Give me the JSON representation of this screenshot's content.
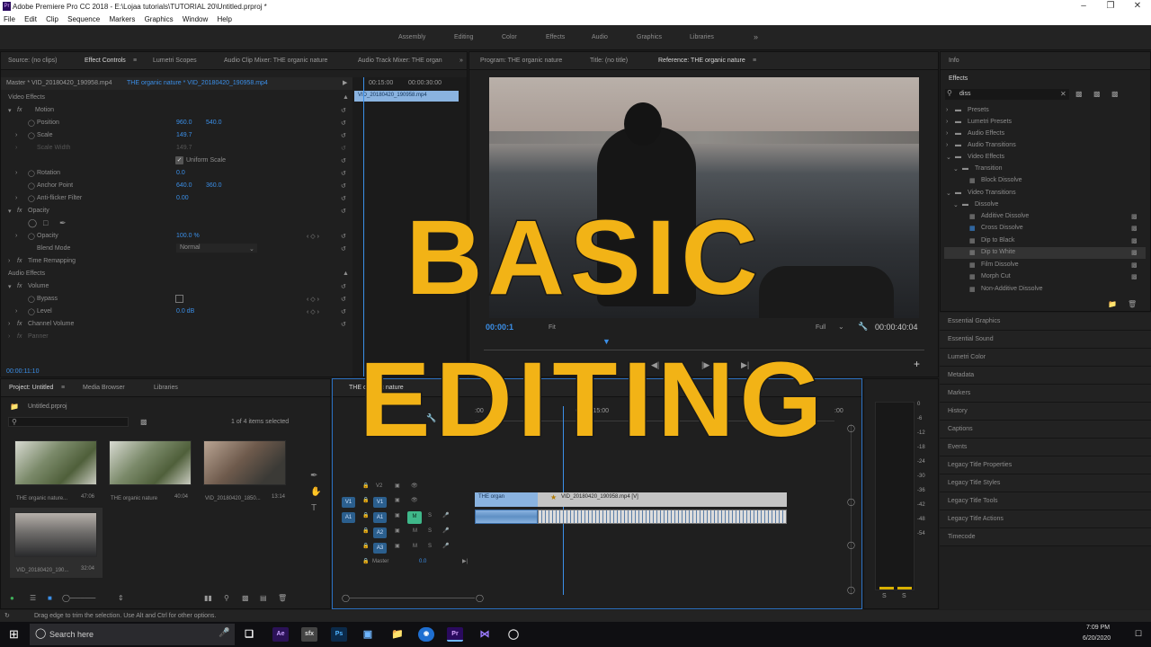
{
  "window": {
    "title": "Adobe Premiere Pro CC 2018 - E:\\Lojaa tutorials\\TUTORIAL 20\\Untitled.prproj *",
    "logo": "Pr"
  },
  "menu": [
    "File",
    "Edit",
    "Clip",
    "Sequence",
    "Markers",
    "Graphics",
    "Window",
    "Help"
  ],
  "workspaces": [
    "Assembly",
    "Editing",
    "Color",
    "Effects",
    "Audio",
    "Graphics",
    "Libraries"
  ],
  "source_tabs": [
    "Source: (no clips)",
    "Effect Controls",
    "Lumetri Scopes",
    "Audio Clip Mixer: THE organic nature",
    "Audio Track Mixer: THE organ"
  ],
  "effect_controls": {
    "master": "Master * VID_20180420_190958.mp4",
    "clip": "THE organic nature * VID_20180420_190958.mp4",
    "video_effects": "Video Effects",
    "motion": "Motion",
    "position_label": "Position",
    "position_x": "960.0",
    "position_y": "540.0",
    "scale_label": "Scale",
    "scale_value": "149.7",
    "scale_width_label": "Scale Width",
    "scale_width_value": "149.7",
    "uniform_scale": "Uniform Scale",
    "rotation_label": "Rotation",
    "rotation_value": "0.0",
    "anchor_label": "Anchor Point",
    "anchor_x": "640.0",
    "anchor_y": "360.0",
    "flicker_label": "Anti-flicker Filter",
    "flicker_value": "0.00",
    "opacity": "Opacity",
    "opacity_label": "Opacity",
    "opacity_value": "100.0 %",
    "blend_label": "Blend Mode",
    "blend_value": "Normal",
    "time_remap": "Time Remapping",
    "audio_effects": "Audio Effects",
    "volume": "Volume",
    "bypass_label": "Bypass",
    "level_label": "Level",
    "level_value": "0.0 dB",
    "channel_volume": "Channel Volume",
    "panner": "Panner",
    "mini_time1": "00:15:00",
    "mini_time2": "00:00:30:00",
    "mini_clip": "VID_20180420_190958.mp4",
    "timecode": "00:00:11:10"
  },
  "program_tabs": [
    "Program: THE organic nature",
    "Title: (no title)",
    "Reference: THE organic nature"
  ],
  "program": {
    "time_left": "00:00:1",
    "fit": "Fit",
    "full": "Full",
    "time_right": "00:00:40:04"
  },
  "project": {
    "tabs": [
      "Project: Untitled",
      "Media Browser",
      "Libraries"
    ],
    "file": "Untitled.prproj",
    "count": "1 of 4 items selected",
    "items": [
      {
        "name": "THE organic nature...",
        "duration": "47:06"
      },
      {
        "name": "THE organic nature",
        "duration": "40:04"
      },
      {
        "name": "VID_20180420_1850...",
        "duration": "13:14"
      },
      {
        "name": "VID_20180420_190...",
        "duration": "32:04"
      }
    ]
  },
  "timeline": {
    "tab": "THE organic nature",
    "timecode": "1:1",
    "ruler1": ":00",
    "ruler2": "00:00:15:00",
    "ruler3": ":00",
    "tracks": [
      "V2",
      "V1",
      "A1",
      "A2",
      "A3"
    ],
    "source_v1": "V1",
    "source_a1": "A1",
    "master_label": "Master",
    "master_value": "0.0",
    "clip1": "THE organ",
    "clip2": "VID_20180420_190958.mp4 [V]",
    "m": "M",
    "s": "S"
  },
  "meter": [
    "0",
    "-6",
    "-12",
    "-18",
    "-24",
    "-30",
    "-36",
    "-42",
    "-48",
    "-54"
  ],
  "meter_buttons": [
    "S",
    "S"
  ],
  "info_tab": "Info",
  "effects": {
    "title": "Effects",
    "search": "diss",
    "tree": [
      {
        "label": "Presets",
        "level": 0
      },
      {
        "label": "Lumetri Presets",
        "level": 0
      },
      {
        "label": "Audio Effects",
        "level": 0
      },
      {
        "label": "Audio Transitions",
        "level": 0
      },
      {
        "label": "Video Effects",
        "level": 0
      },
      {
        "label": "Transition",
        "level": 1
      },
      {
        "label": "Block Dissolve",
        "level": 2
      },
      {
        "label": "Video Transitions",
        "level": 0
      },
      {
        "label": "Dissolve",
        "level": 1
      },
      {
        "label": "Additive Dissolve",
        "level": 2
      },
      {
        "label": "Cross Dissolve",
        "level": 2
      },
      {
        "label": "Dip to Black",
        "level": 2
      },
      {
        "label": "Dip to White",
        "level": 2
      },
      {
        "label": "Film Dissolve",
        "level": 2
      },
      {
        "label": "Morph Cut",
        "level": 2
      },
      {
        "label": "Non-Additive Dissolve",
        "level": 2
      }
    ]
  },
  "side_panels": [
    "Essential Graphics",
    "Essential Sound",
    "Lumetri Color",
    "Metadata",
    "Markers",
    "History",
    "Captions",
    "Events",
    "Legacy Title Properties",
    "Legacy Title Styles",
    "Legacy Title Tools",
    "Legacy Title Actions",
    "Timecode"
  ],
  "status": "Drag edge to trim the selection. Use Alt and Ctrl for other options.",
  "overlay": {
    "line1": "BASIC",
    "line2": "EDITING"
  },
  "taskbar": {
    "search": "Search here",
    "time": "7:09 PM",
    "date": "6/20/2020"
  }
}
